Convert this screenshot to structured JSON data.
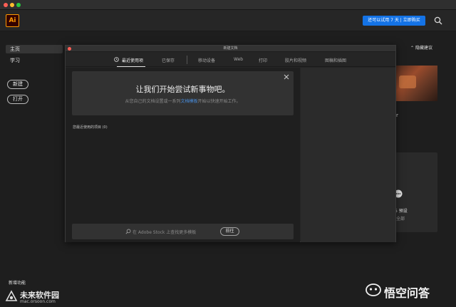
{
  "app": {
    "logo_text": "Ai",
    "trial_button": "还可以试用 7 天 | 立即购买"
  },
  "sidebar": {
    "items": [
      {
        "label": "主页"
      },
      {
        "label": "学习"
      }
    ],
    "new_button": "新建",
    "open_button": "打开",
    "new_features": "新增功能"
  },
  "home": {
    "hide_suggestions": "隐藏建议",
    "card_text": "r",
    "preset_label": "5 预设",
    "preset_sub": "全部"
  },
  "dialog": {
    "title": "新建文档",
    "tabs": [
      {
        "label": "最近使用项",
        "active": true
      },
      {
        "label": "已保存"
      },
      {
        "label": "移动设备"
      },
      {
        "label": "Web"
      },
      {
        "label": "打印"
      },
      {
        "label": "胶片和视频"
      },
      {
        "label": "图稿和插图"
      }
    ],
    "welcome_title": "让我们开始尝试新事物吧。",
    "welcome_sub_before": "从您自己的文档设置或一系列",
    "welcome_sub_link": "文档模板",
    "welcome_sub_after": "开始以快速开始工作。",
    "recent_items_label": "您最近使用的项目 (0)",
    "stock_placeholder": "在 Adobe Stock 上查找更多模板",
    "go_button": "前往"
  },
  "watermarks": {
    "left_name": "未来软件园",
    "left_url": "mac.orsoon.com",
    "right_name": "悟空问答"
  },
  "colors": {
    "accent": "#1473e6",
    "ai_orange": "#ff9a00",
    "background": "#1e1e1e"
  }
}
